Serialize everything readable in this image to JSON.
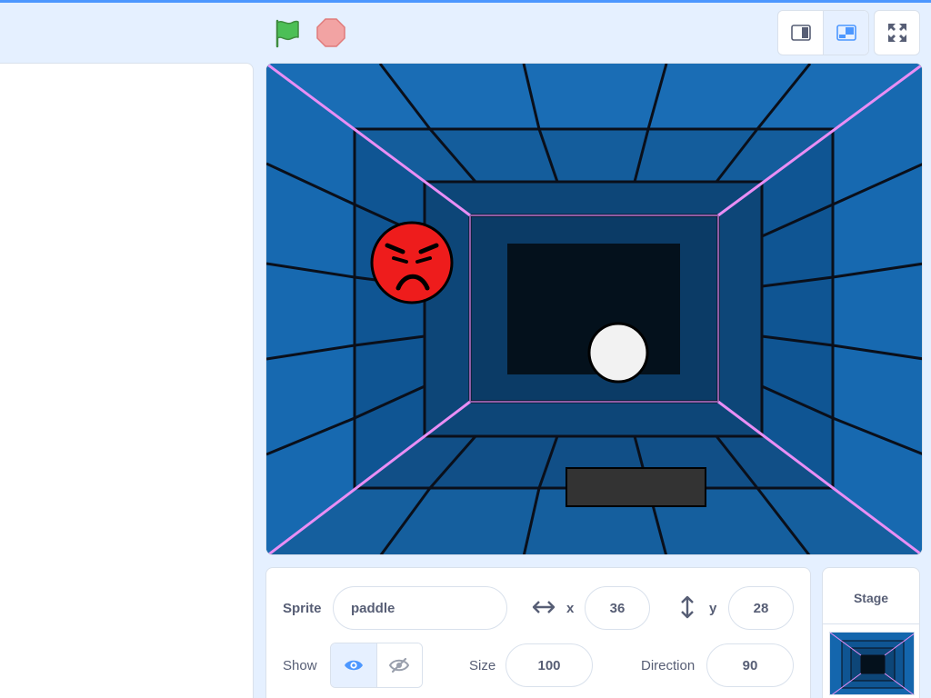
{
  "header": {
    "green_flag_icon": "green-flag-icon",
    "stop_icon": "stop-sign-icon",
    "layout_buttons": [
      "small-stage-icon",
      "normal-stage-icon"
    ],
    "fullscreen_icon": "fullscreen-icon"
  },
  "colors": {
    "accent": "#4c97ff",
    "flag": "#4cbf56",
    "stop": "#ec5959",
    "panel_border": "#d9e1ec",
    "stage_background": "#0c4f8c"
  },
  "stage_sprites": [
    "angry-face",
    "ball",
    "paddle"
  ],
  "sprite_info": {
    "sprite_label": "Sprite",
    "sprite_name": "paddle",
    "x_label": "x",
    "x_value": "36",
    "y_label": "y",
    "y_value": "28",
    "show_label": "Show",
    "size_label": "Size",
    "size_value": "100",
    "direction_label": "Direction",
    "direction_value": "90"
  },
  "stage_panel": {
    "title": "Stage"
  }
}
